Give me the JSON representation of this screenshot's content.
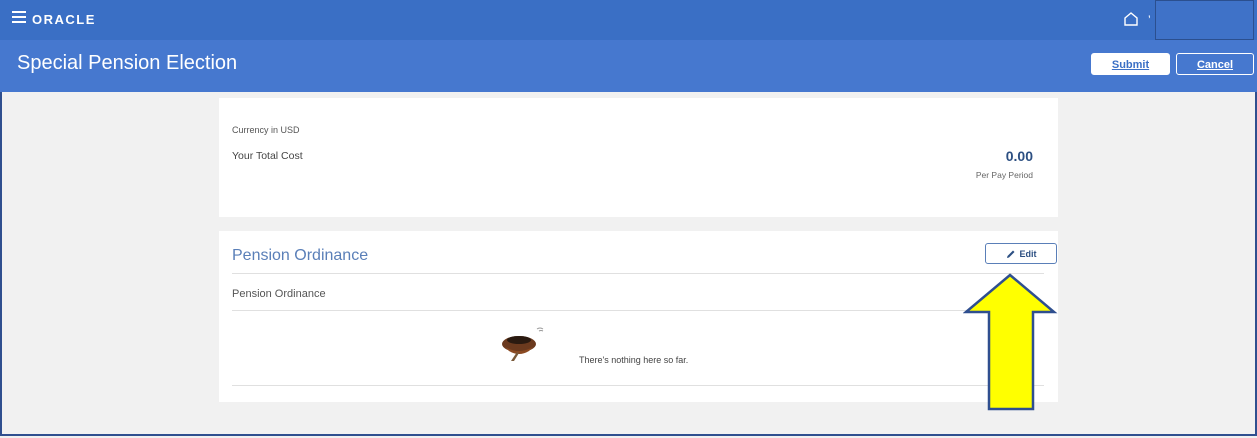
{
  "topbar": {
    "logo": "ORACLE",
    "user_initial": "’",
    "icons": {
      "menu": "hamburger-icon",
      "home": "home-icon"
    }
  },
  "header": {
    "title": "Special Pension Election",
    "submit_label": "Submit",
    "cancel_label": "Cancel"
  },
  "cost_card": {
    "currency_note": "Currency in USD",
    "total_label": "Your Total Cost",
    "amount": "0.00",
    "period": "Per Pay Period"
  },
  "pension_card": {
    "title": "Pension Ordinance",
    "edit_label": "Edit",
    "subsection_title": "Pension Ordinance",
    "empty_message": "There's nothing here so far.",
    "icons": {
      "edit": "pencil-icon",
      "empty": "empty-nest-icon"
    }
  },
  "annotation": {
    "arrow_color": "#ffff00",
    "arrow_outline": "#2f4f8f"
  },
  "colors": {
    "brand": "#3a6fc5",
    "header": "#4678cf"
  }
}
